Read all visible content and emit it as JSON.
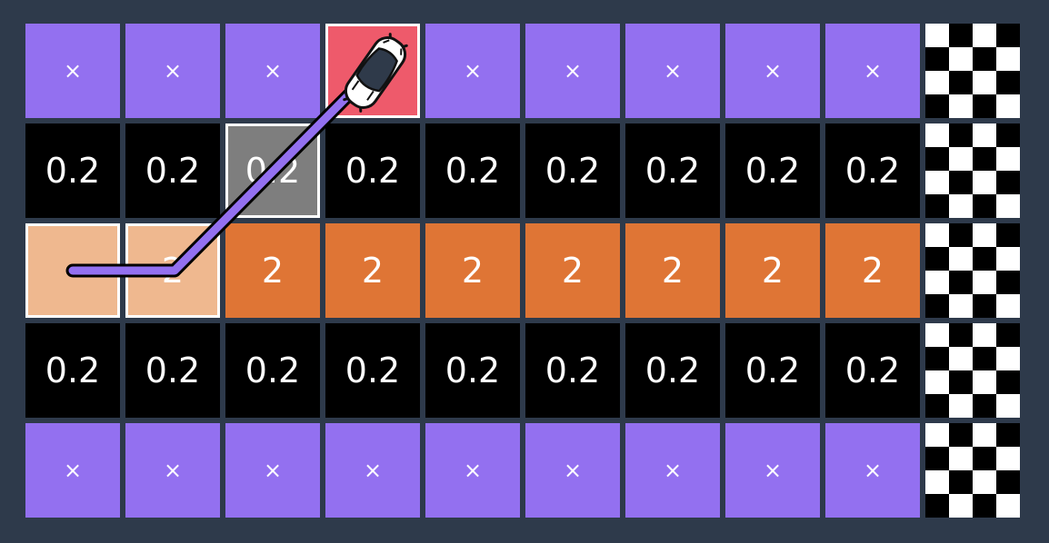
{
  "grid": {
    "rows": [
      [
        {
          "kind": "wall",
          "label": "×"
        },
        {
          "kind": "wall",
          "label": "×"
        },
        {
          "kind": "wall",
          "label": "×"
        },
        {
          "kind": "car",
          "label": ""
        },
        {
          "kind": "wall",
          "label": "×"
        },
        {
          "kind": "wall",
          "label": "×"
        },
        {
          "kind": "wall",
          "label": "×"
        },
        {
          "kind": "wall",
          "label": "×"
        },
        {
          "kind": "wall",
          "label": "×"
        },
        {
          "kind": "finish",
          "label": ""
        }
      ],
      [
        {
          "kind": "track",
          "label": "0.2"
        },
        {
          "kind": "track",
          "label": "0.2"
        },
        {
          "kind": "track",
          "label": "0.2",
          "visited": true
        },
        {
          "kind": "track",
          "label": "0.2"
        },
        {
          "kind": "track",
          "label": "0.2"
        },
        {
          "kind": "track",
          "label": "0.2"
        },
        {
          "kind": "track",
          "label": "0.2"
        },
        {
          "kind": "track",
          "label": "0.2"
        },
        {
          "kind": "track",
          "label": "0.2"
        },
        {
          "kind": "finish",
          "label": ""
        }
      ],
      [
        {
          "kind": "boost",
          "label": "",
          "visited": true
        },
        {
          "kind": "boost",
          "label": "2",
          "visited": true
        },
        {
          "kind": "boost",
          "label": "2"
        },
        {
          "kind": "boost",
          "label": "2"
        },
        {
          "kind": "boost",
          "label": "2"
        },
        {
          "kind": "boost",
          "label": "2"
        },
        {
          "kind": "boost",
          "label": "2"
        },
        {
          "kind": "boost",
          "label": "2"
        },
        {
          "kind": "boost",
          "label": "2"
        },
        {
          "kind": "finish",
          "label": ""
        }
      ],
      [
        {
          "kind": "track",
          "label": "0.2"
        },
        {
          "kind": "track",
          "label": "0.2"
        },
        {
          "kind": "track",
          "label": "0.2"
        },
        {
          "kind": "track",
          "label": "0.2"
        },
        {
          "kind": "track",
          "label": "0.2"
        },
        {
          "kind": "track",
          "label": "0.2"
        },
        {
          "kind": "track",
          "label": "0.2"
        },
        {
          "kind": "track",
          "label": "0.2"
        },
        {
          "kind": "track",
          "label": "0.2"
        },
        {
          "kind": "finish",
          "label": ""
        }
      ],
      [
        {
          "kind": "wall",
          "label": "×"
        },
        {
          "kind": "wall",
          "label": "×"
        },
        {
          "kind": "wall",
          "label": "×"
        },
        {
          "kind": "wall",
          "label": "×"
        },
        {
          "kind": "wall",
          "label": "×"
        },
        {
          "kind": "wall",
          "label": "×"
        },
        {
          "kind": "wall",
          "label": "×"
        },
        {
          "kind": "wall",
          "label": "×"
        },
        {
          "kind": "wall",
          "label": "×"
        },
        {
          "kind": "finish",
          "label": ""
        }
      ]
    ]
  },
  "path": [
    [
      2,
      0
    ],
    [
      2,
      1
    ],
    [
      0,
      3
    ]
  ],
  "car": {
    "row": 0,
    "col": 3,
    "icon": "race-car-icon"
  },
  "colors": {
    "background": "#2e3a4b",
    "wall": "#9370f0",
    "track": "#000000",
    "boost": "#df7535",
    "boost_visited": "#efb88f",
    "track_visited": "#7e7e7e",
    "car_cell": "#ee5a6b",
    "path": "#9370f0"
  }
}
